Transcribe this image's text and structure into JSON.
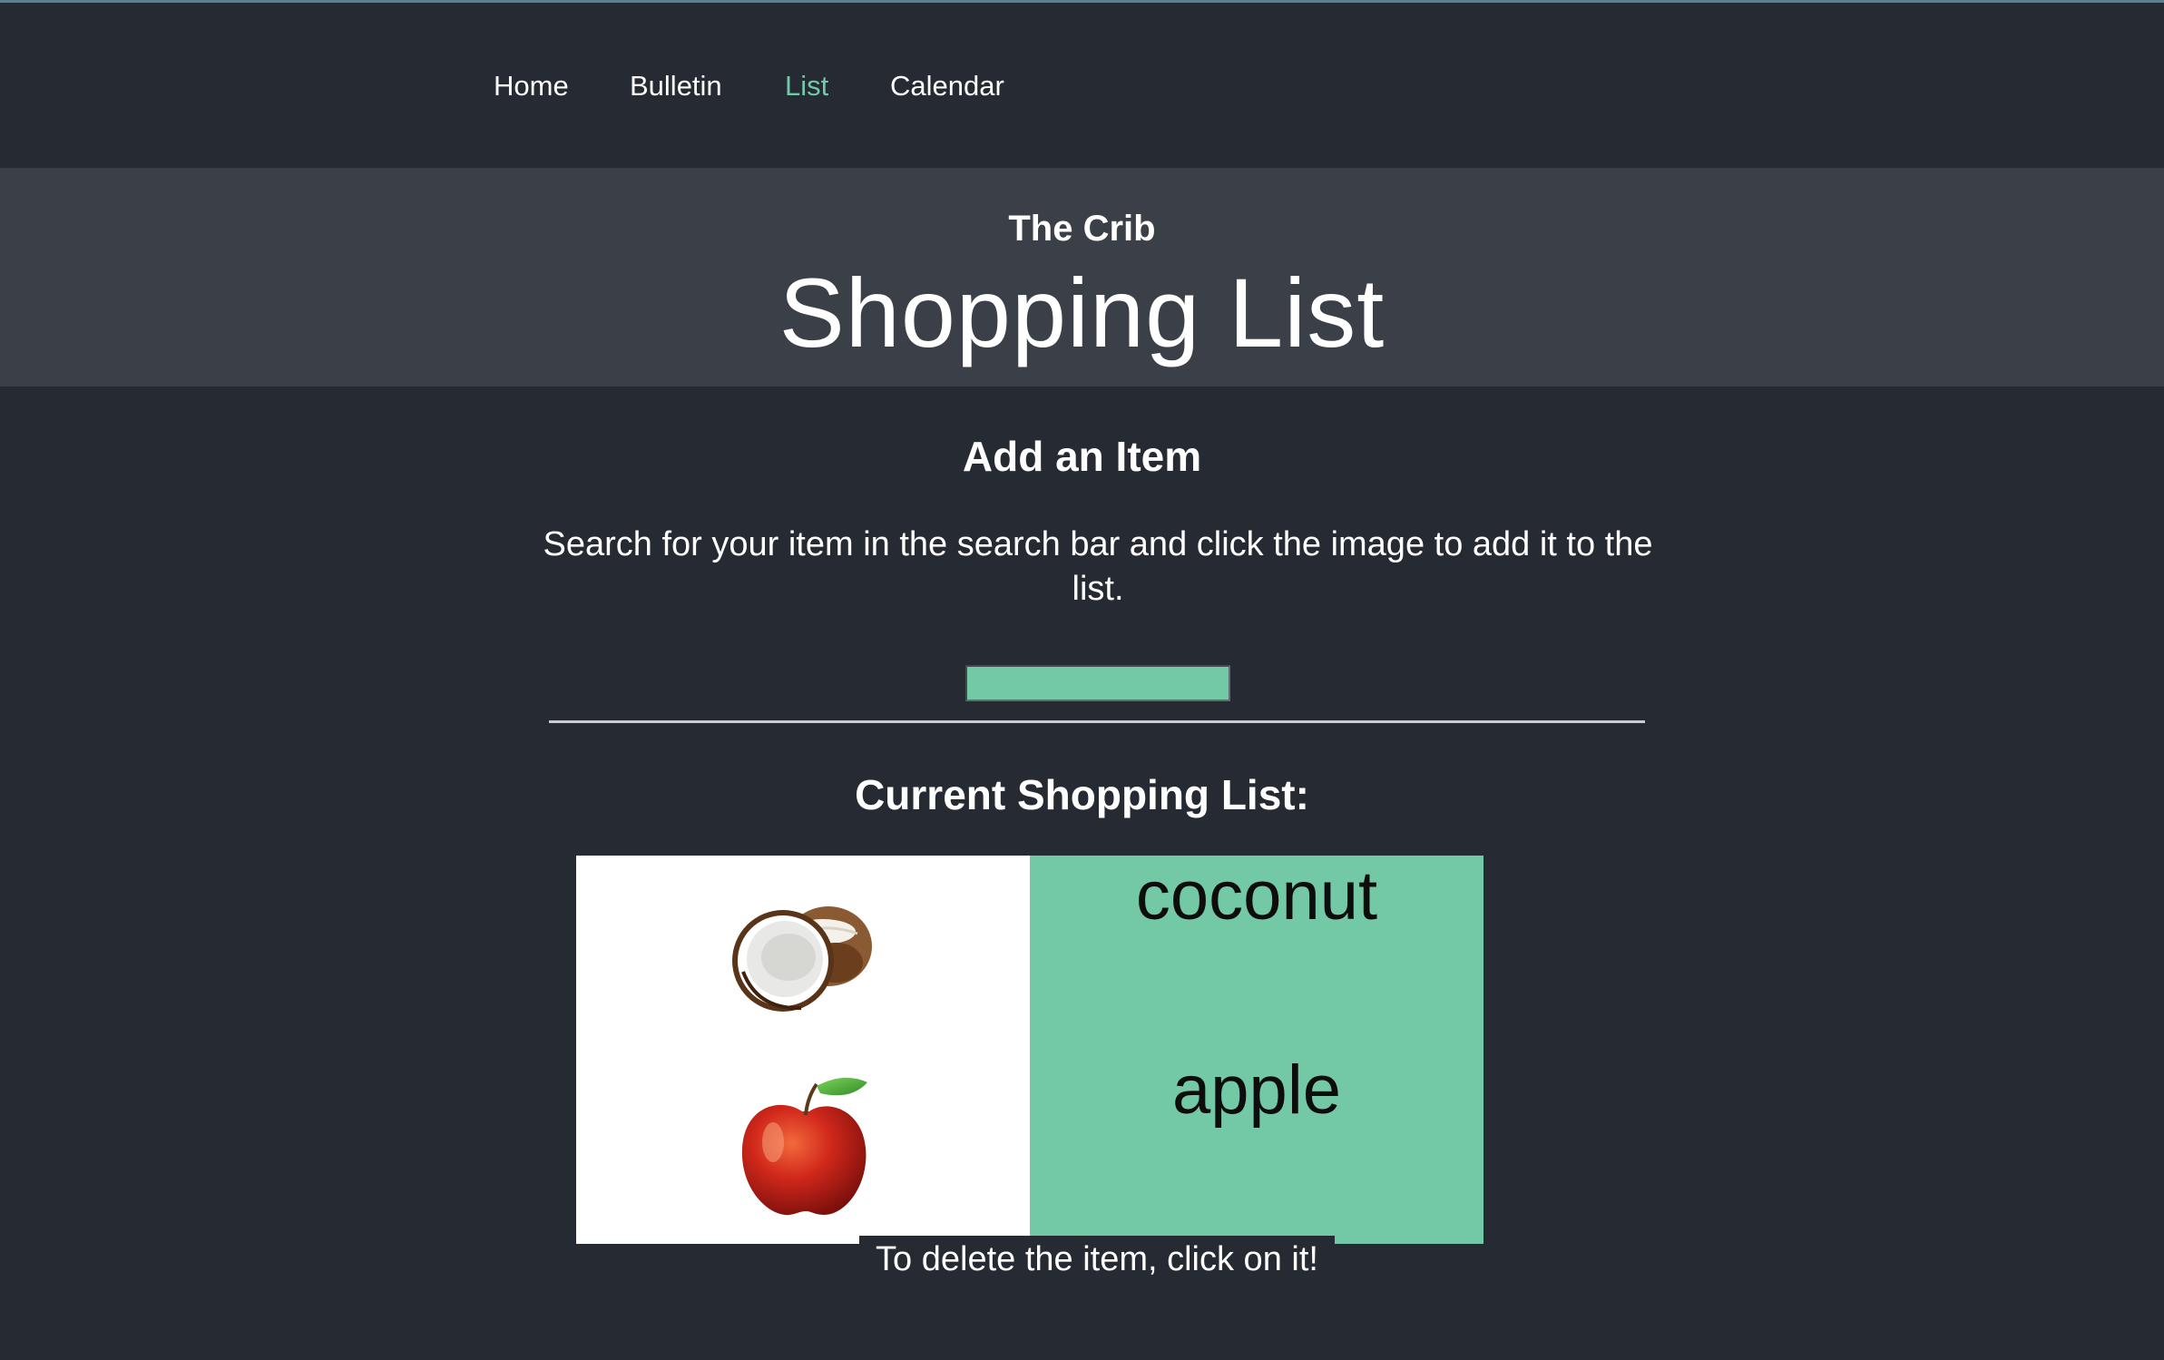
{
  "nav": {
    "items": [
      {
        "label": "Home",
        "active": false
      },
      {
        "label": "Bulletin",
        "active": false
      },
      {
        "label": "List",
        "active": true
      },
      {
        "label": "Calendar",
        "active": false
      }
    ]
  },
  "header": {
    "site_name": "The Crib",
    "page_title": "Shopping List"
  },
  "add_item": {
    "heading": "Add an Item",
    "instructions": "Search for your item in the search bar and click the image to add it to the list.",
    "search_value": "",
    "search_placeholder": ""
  },
  "shopping_list": {
    "heading": "Current Shopping List:",
    "items": [
      {
        "name": "coconut",
        "icon": "coconut-image"
      },
      {
        "name": "apple",
        "icon": "apple-image"
      }
    ],
    "delete_hint": "To delete the item, click on it!"
  },
  "colors": {
    "background": "#252a33",
    "header_band": "#3a3f48",
    "accent": "#73c9a6",
    "text": "#ffffff"
  }
}
